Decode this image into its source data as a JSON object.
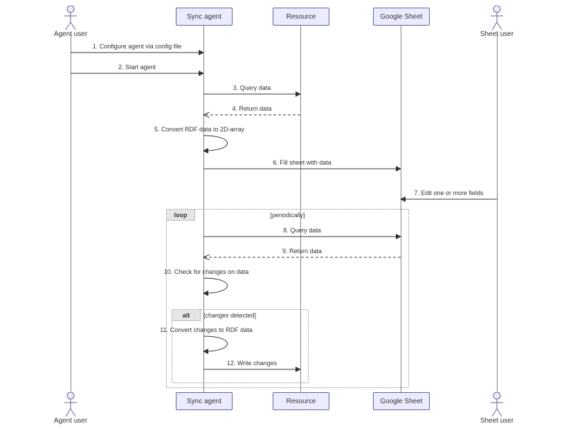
{
  "chart_data": {
    "type": "sequence-diagram",
    "participants": [
      {
        "id": "agent-user",
        "label": "Agent user",
        "kind": "actor"
      },
      {
        "id": "sync-agent",
        "label": "Sync agent",
        "kind": "box"
      },
      {
        "id": "resource",
        "label": "Resource",
        "kind": "box"
      },
      {
        "id": "google-sheet",
        "label": "Google Sheet",
        "kind": "box"
      },
      {
        "id": "sheet-user",
        "label": "Sheet user",
        "kind": "actor"
      }
    ],
    "messages": [
      {
        "n": 1,
        "from": "agent-user",
        "to": "sync-agent",
        "text": "Configure agent via config file",
        "style": "solid"
      },
      {
        "n": 2,
        "from": "agent-user",
        "to": "sync-agent",
        "text": "Start agent",
        "style": "solid"
      },
      {
        "n": 3,
        "from": "sync-agent",
        "to": "resource",
        "text": "Query data",
        "style": "solid"
      },
      {
        "n": 4,
        "from": "resource",
        "to": "sync-agent",
        "text": "Return data",
        "style": "dashed"
      },
      {
        "n": 5,
        "from": "sync-agent",
        "to": "sync-agent",
        "text": "Convert RDF data to 2D-array",
        "style": "self"
      },
      {
        "n": 6,
        "from": "sync-agent",
        "to": "google-sheet",
        "text": "Fill sheet with data",
        "style": "solid"
      },
      {
        "n": 7,
        "from": "sheet-user",
        "to": "google-sheet",
        "text": "Edit one or more fields",
        "style": "solid"
      },
      {
        "n": 8,
        "from": "sync-agent",
        "to": "google-sheet",
        "text": "Query data",
        "style": "solid",
        "frame": "loop"
      },
      {
        "n": 9,
        "from": "google-sheet",
        "to": "sync-agent",
        "text": "Return data",
        "style": "dashed",
        "frame": "loop"
      },
      {
        "n": 10,
        "from": "sync-agent",
        "to": "sync-agent",
        "text": "Check for changes on data",
        "style": "self",
        "frame": "loop"
      },
      {
        "n": 11,
        "from": "sync-agent",
        "to": "sync-agent",
        "text": "Convert changes to RDF data",
        "style": "self",
        "frame": "alt"
      },
      {
        "n": 12,
        "from": "sync-agent",
        "to": "resource",
        "text": "Write changes",
        "style": "solid",
        "frame": "alt"
      }
    ],
    "frames": [
      {
        "id": "loop",
        "label": "loop",
        "guard": "[periodically]",
        "encloses": [
          "sync-agent",
          "google-sheet"
        ],
        "messages": [
          8,
          9,
          10,
          11,
          12
        ]
      },
      {
        "id": "alt",
        "label": "alt",
        "guard": "[changes detected]",
        "encloses": [
          "sync-agent"
        ],
        "messages": [
          11,
          12
        ]
      }
    ]
  },
  "labels": {
    "agent_user": "Agent user",
    "sync_agent": "Sync agent",
    "resource": "Resource",
    "google_sheet": "Google Sheet",
    "sheet_user": "Sheet user",
    "m1": "1. Configure agent via config file",
    "m2": "2. Start agent",
    "m3": "3. Query data",
    "m4": "4. Return data",
    "m5": "5. Convert RDF data to 2D-array",
    "m6": "6. Fill sheet with data",
    "m7": "7. Edit one or more fields",
    "m8": "8. Query data",
    "m9": "9. Return data",
    "m10": "10. Check for changes on data",
    "m11": "11. Convert changes to RDF data",
    "m12": "12. Write changes",
    "loop": "loop",
    "loop_guard": "[periodically]",
    "alt": "alt",
    "alt_guard": "[changes detected]"
  }
}
